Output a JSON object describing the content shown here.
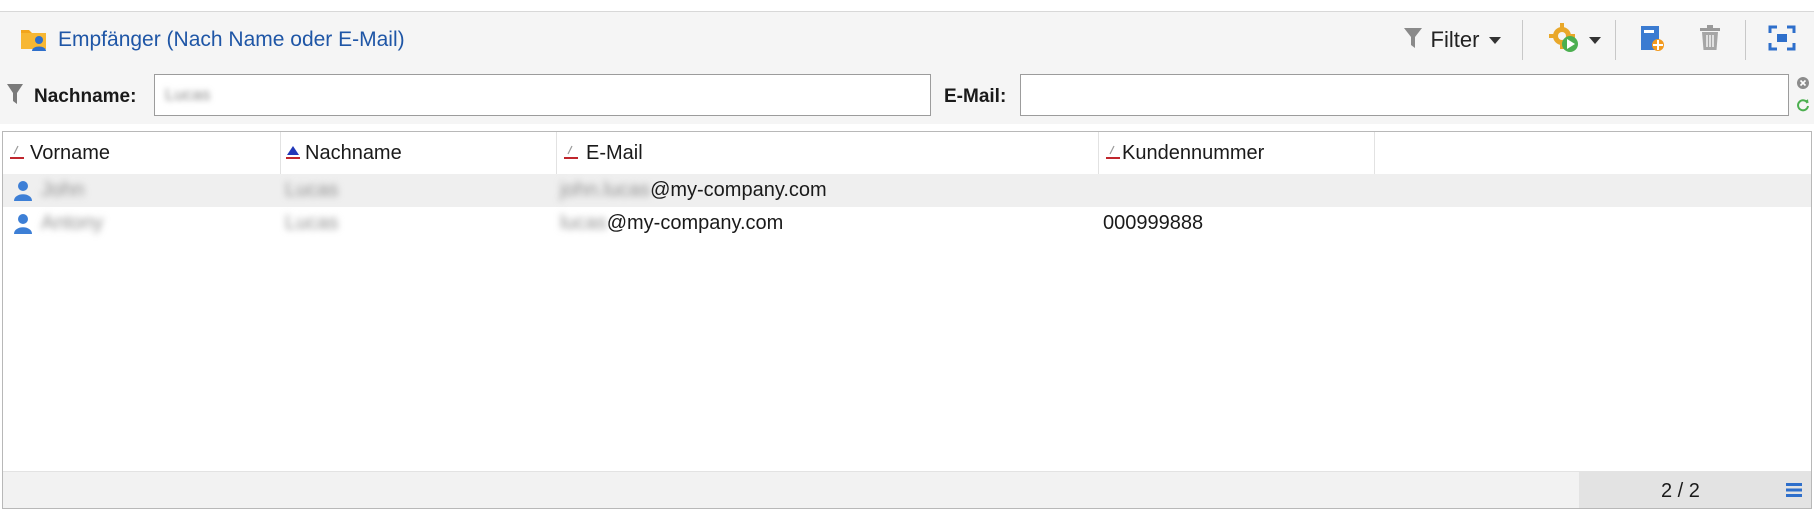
{
  "toolbar": {
    "title": "Empfänger (Nach Name oder E-Mail)",
    "filter_label": "Filter",
    "icons": {
      "title": "recipient-folder-icon",
      "filter": "funnel-icon",
      "actions": "gear-play-icon",
      "new": "new-recipient-icon",
      "delete": "trash-icon",
      "fit": "fit-screen-icon"
    }
  },
  "filter": {
    "lastname_label": "Nachname:",
    "lastname_value": "Lucas",
    "email_label": "E-Mail:",
    "email_value": ""
  },
  "grid": {
    "columns": [
      "Vorname",
      "Nachname",
      "E-Mail",
      "Kundennummer"
    ],
    "sorted_column": "Nachname",
    "rows": [
      {
        "firstname": "John",
        "lastname": "Lucas",
        "email_local": "john.lucas",
        "email_domain": "@my-company.com",
        "customer_no": ""
      },
      {
        "firstname": "Antony",
        "lastname": "Lucas",
        "email_local": "lucas",
        "email_domain": "@my-company.com",
        "customer_no": "000999888"
      }
    ],
    "count": "2 / 2"
  },
  "colors": {
    "accent": "#1f56a6",
    "person_icon": "#3d7fd6",
    "sort_indicator": "#c0262d"
  }
}
